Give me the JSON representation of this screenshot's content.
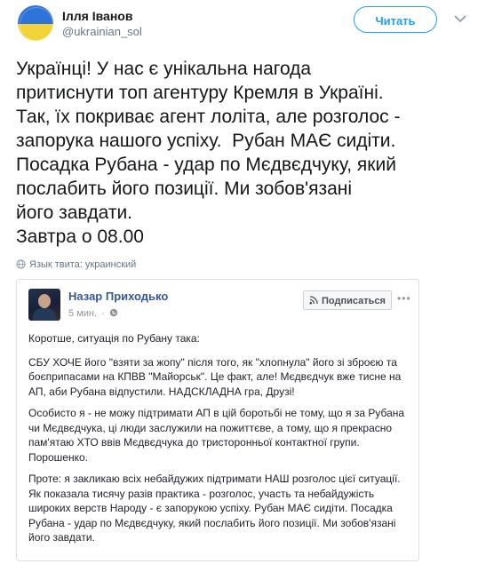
{
  "author": {
    "name": "Ілля Іванов",
    "handle": "@ukrainian_sol"
  },
  "follow_button": "Читать",
  "tweet_text": "Українці! У нас є унікальна нагода\nпритиснути топ агентуру Кремля в Україні.\nТак, їх покриває агент лоліта, але розголос -\nзапорука нашого успіху.  Рубан МАЄ сидіти.\nПосадка Рубана - удар по Мєдвєдчуку, який\nпослабить його позиції. Ми зобов'язані\nйого завдати.\nЗавтра о 08.00",
  "tweet_language": "Язык твита: украинский",
  "embedded_post": {
    "author_name": "Назар Приходько",
    "time": "5 мин.",
    "subscribe_label": "Подписаться",
    "paragraphs": [
      "Коротше, ситуація по Рубану така:",
      "СБУ ХОЧЕ його \"взяти за жопу\" після того, як \"хлопнула\" його зі зброєю та боєприпасами на КПВВ \"Майорськ\". Це факт, але! Мєдвєдчук вже тисне на АП, аби Рубана відпустили. НАДСКЛАДНА гра, Друзі!",
      "Особисто я - не можу підтримати АП в цій боротьбі не тому, що я за Рубана чи Мєдвєдчука, ці люди заслужили на пожиттєве, а тому, що я прекрасно пам'ятаю ХТО ввів Мєдвєдчука до тристоронньої контактної групи. Порошенко.",
      "Проте: я закликаю всіх небайдужих підтримати НАШ розголос цієї ситуації. Як показала тисячу разів практика - розголос, участь та небайдужість широких верств Народу - є запорукою успіху. Рубан МАЄ сидіти. Посадка Рубана - удар по Мєдвєдчуку, який послабить його позиції. Ми зобов'язані його завдати."
    ]
  },
  "icons": {
    "avatar_colors": [
      "#2e74d8",
      "#f2d43a"
    ],
    "accent": "#1da1f2",
    "fb_link": "#365899"
  }
}
